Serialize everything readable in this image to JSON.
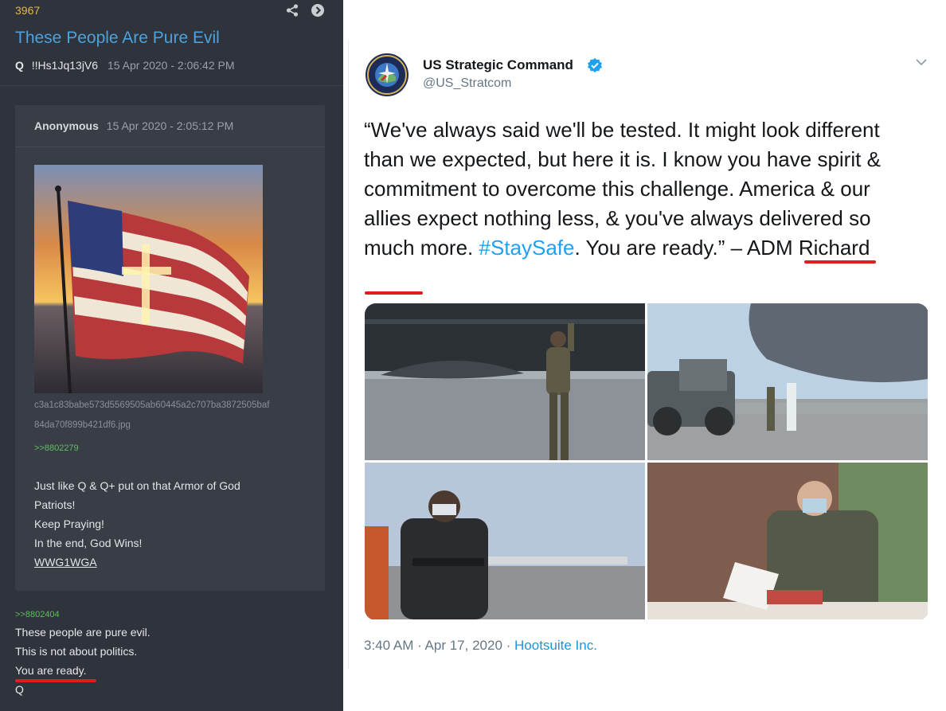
{
  "board": {
    "post_number": "3967",
    "title": "These People Are Pure Evil",
    "author": "Q",
    "tripcode": "!!Hs1Jq13jV6",
    "timestamp": "15 Apr 2020 - 2:06:42 PM",
    "quote": {
      "author": "Anonymous",
      "timestamp": "15 Apr 2020 - 2:05:12 PM",
      "filename_line1": "c3a1c83babe573d5569505ab60445a2c707ba3872505baf",
      "filename_line2": "84da70f899b421df6.jpg",
      "reply_link": ">>8802279",
      "lines": [
        "Just like Q & Q+ put on that Armor of God",
        "Patriots!",
        "Keep Praying!",
        "In the end, God Wins!",
        "WWG1WGA"
      ]
    },
    "reply": {
      "link": ">>8802404",
      "lines": [
        "These people are pure evil.",
        "This is not about politics.",
        "You are ready.",
        "Q"
      ]
    }
  },
  "tweet": {
    "name": "US Strategic Command",
    "handle": "@US_Stratcom",
    "text_before": "“We've always said we'll be tested. It might look different than we expected, but here it is. I know you have spirit & commitment to overcome this challenge. America & our allies expect nothing less, & you've always delivered so much more. ",
    "hashtag": "#StaySafe",
    "text_after": ". You are ready.” – ADM Richard",
    "time": "3:40 AM · Apr 17, 2020 · ",
    "source": "Hootsuite Inc."
  },
  "colors": {
    "board_bg": "#2f333b",
    "title_blue": "#4aa3df",
    "post_number_yellow": "#e0b94c",
    "quote_link_green": "#5fbf5f",
    "twitter_blue": "#1da1f2",
    "underline_red": "#dc1f1f"
  },
  "icons": [
    "share-icon",
    "forward-arrow-icon",
    "verified-badge-icon",
    "chevron-down-icon"
  ]
}
